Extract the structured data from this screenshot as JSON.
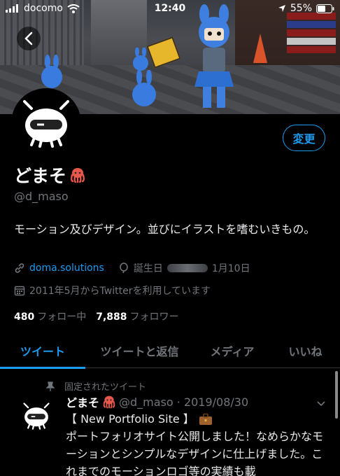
{
  "status_bar": {
    "carrier": "docomo",
    "time": "12:40",
    "battery": "55%"
  },
  "profile": {
    "edit_button": "変更",
    "name": "どまそ",
    "handle": "@d_maso",
    "bio": "モーション及びデザイン。並びにイラストを嗜むいきもの。",
    "website": "doma.solutions",
    "birthday_prefix": "誕生日",
    "birthday_suffix": "1月10日",
    "joined": "2011年5月からTwitterを利用しています",
    "following_count": "480",
    "following_label": "フォロー中",
    "followers_count": "7,888",
    "followers_label": "フォロワー"
  },
  "tabs": [
    {
      "label": "ツイート",
      "active": true
    },
    {
      "label": "ツイートと返信",
      "active": false
    },
    {
      "label": "メディア",
      "active": false
    },
    {
      "label": "いいね",
      "active": false
    }
  ],
  "tweet": {
    "pinned_label": "固定されたツイート",
    "name": "どまそ",
    "handle_date": "@d_maso · 2019/08/30",
    "body_line1": "【 New Portfolio Site 】",
    "body_line2": "ポートフォリオサイト公開しました！なめらかなモーションとシンプルなデザインに仕上げました。これまでのモーションロゴ等の実績も載"
  },
  "colors": {
    "accent": "#1d9bf0",
    "background": "#000000",
    "secondary_text": "#71767b"
  },
  "icons": {
    "back": "chevron-left-icon",
    "octopus": "octopus-emoji",
    "link": "link-icon",
    "balloon": "balloon-icon",
    "calendar": "calendar-icon",
    "pin": "pin-icon",
    "briefcase": "briefcase-emoji",
    "more": "chevron-down-icon"
  }
}
